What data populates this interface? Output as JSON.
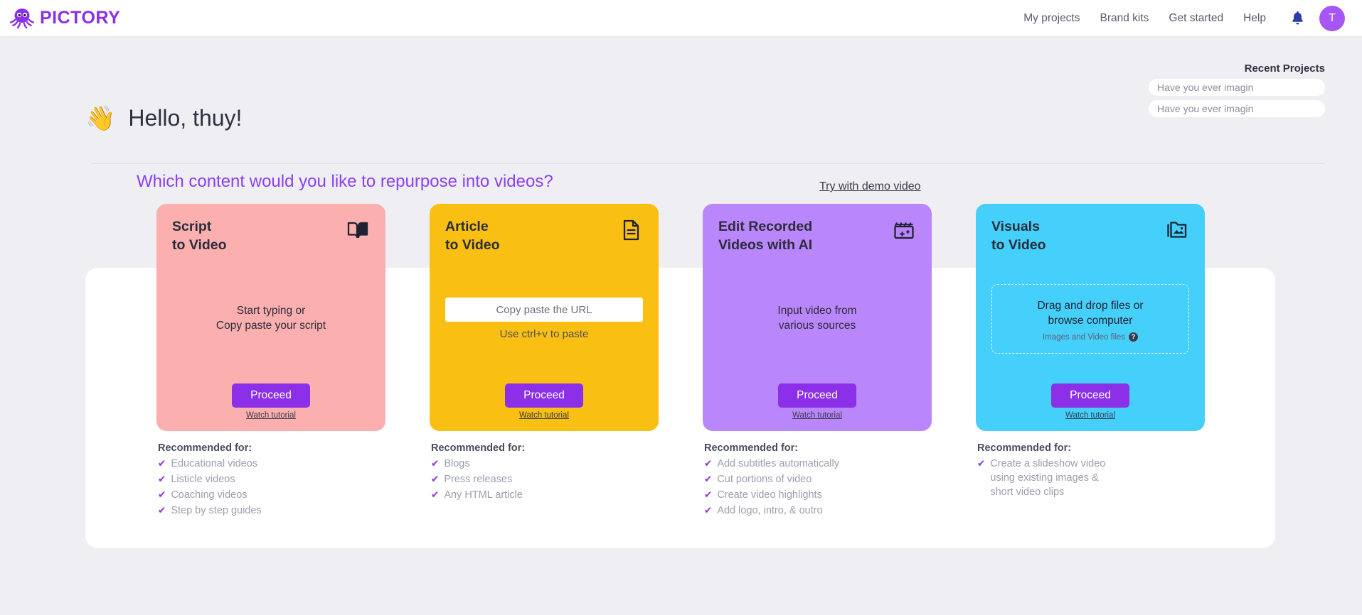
{
  "brand": {
    "name": "PICTORY",
    "logo_icon": "octopus-logo-icon",
    "color": "#8B2FE8"
  },
  "nav": {
    "links": [
      {
        "label": "My projects"
      },
      {
        "label": "Brand kits"
      },
      {
        "label": "Get started"
      },
      {
        "label": "Help"
      }
    ],
    "bell_icon": "notification-bell-icon",
    "avatar_initial": "T"
  },
  "recent": {
    "title": "Recent Projects",
    "items": [
      {
        "label": "Have you ever imagin"
      },
      {
        "label": "Have you ever imagin"
      }
    ]
  },
  "greeting": {
    "emoji": "👋",
    "text": "Hello, thuy!"
  },
  "prompt": {
    "question": "Which content would you like to repurpose into videos?",
    "demo_link": "Try with demo video"
  },
  "cards": [
    {
      "id": "script-to-video",
      "title": "Script\nto Video",
      "icon": "open-book-icon",
      "bg": "#FBAFAF",
      "body_type": "text",
      "center_text": "Start typing or\nCopy paste your script",
      "proceed_label": "Proceed",
      "watch_label": "Watch tutorial",
      "rec_title": "Recommended for:",
      "rec_items": [
        "Educational videos",
        "Listicle videos",
        "Coaching videos",
        "Step by step guides"
      ]
    },
    {
      "id": "article-to-video",
      "title": "Article\nto Video",
      "icon": "document-icon",
      "bg": "#F9C013",
      "body_type": "input",
      "input_placeholder": "Copy paste the URL",
      "input_value": "",
      "hint": "Use ctrl+v to paste",
      "proceed_label": "Proceed",
      "watch_label": "Watch tutorial",
      "rec_title": "Recommended for:",
      "rec_items": [
        "Blogs",
        "Press releases",
        "Any HTML article"
      ]
    },
    {
      "id": "edit-recorded-videos",
      "title": "Edit Recorded\nVideos with AI",
      "icon": "clapperboard-ai-icon",
      "bg": "#BA86FB",
      "body_type": "text",
      "center_text": "Input video from\nvarious sources",
      "proceed_label": "Proceed",
      "watch_label": "Watch tutorial",
      "rec_title": "Recommended for:",
      "rec_items": [
        "Add subtitles automatically",
        "Cut portions of video",
        "Create video highlights",
        "Add logo, intro, & outro"
      ]
    },
    {
      "id": "visuals-to-video",
      "title": "Visuals\nto Video",
      "icon": "image-folder-icon",
      "bg": "#45D0FC",
      "body_type": "dropzone",
      "dropzone_main": "Drag and drop files or\nbrowse computer",
      "dropzone_sub": "Images and Video files",
      "dropzone_help_icon": "help-circle-icon",
      "proceed_label": "Proceed",
      "watch_label": "Watch tutorial",
      "rec_title": "Recommended for:",
      "rec_items": [
        "Create a slideshow video\nusing existing images &\nshort video clips"
      ]
    }
  ]
}
